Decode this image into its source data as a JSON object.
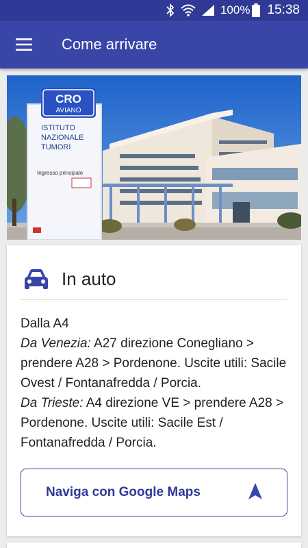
{
  "status_bar": {
    "battery": "100%",
    "time": "15:38",
    "icons": [
      "bluetooth-icon",
      "wifi-icon",
      "signal-icon",
      "battery-icon"
    ]
  },
  "app_bar": {
    "title": "Come arrivare",
    "menu_icon": "hamburger-menu-icon"
  },
  "hero_image": {
    "sign_logo_line1": "CRO",
    "sign_logo_line2": "AVIANO",
    "sign_text_1": "ISTITUTO",
    "sign_text_2": "NAZIONALE",
    "sign_text_3": "TUMORI",
    "sign_entrance": "Ingresso principale"
  },
  "card": {
    "icon": "car-icon",
    "title": "In auto",
    "heading": "Dalla A4",
    "route1_label": "Da Venezia:",
    "route1_text": " A27 direzione Conegliano > prendere A28 > Pordenone. Uscite utili: Sacile Ovest / Fontanafredda / Porcia.",
    "route2_label": "Da Trieste:",
    "route2_text": " A4 direzione VE > prendere A28 > Pordenone. Uscite utili: Sacile Est / Fontanafredda / Porcia.",
    "button_label": "Naviga con Google Maps",
    "button_icon": "navigation-arrow-icon"
  },
  "colors": {
    "primary": "#3a45a8",
    "status_bar": "#303a96",
    "accent_text": "#2f3a99"
  }
}
